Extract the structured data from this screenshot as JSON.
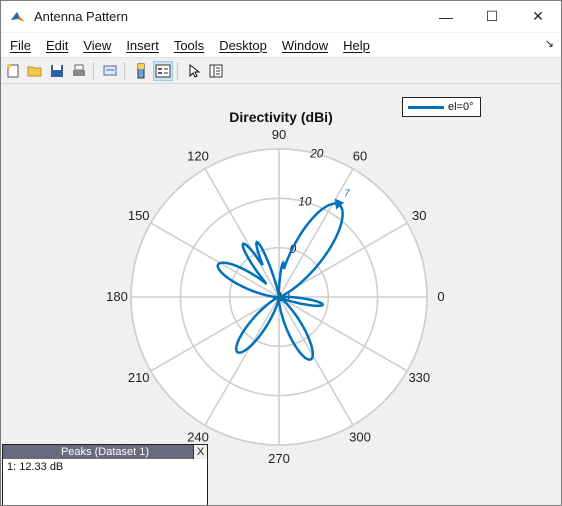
{
  "window": {
    "title": "Antenna Pattern",
    "controls": {
      "minimize": "—",
      "maximize": "☐",
      "close": "✕"
    }
  },
  "menu": {
    "items": [
      "File",
      "Edit",
      "View",
      "Insert",
      "Tools",
      "Desktop",
      "Window",
      "Help"
    ],
    "dock_arrow": "↘"
  },
  "toolbar": {
    "buttons": [
      "new-figure",
      "open-file",
      "save",
      "print",
      "link",
      "insert-colorbar",
      "insert-legend",
      "edit-plot",
      "property-inspector"
    ]
  },
  "chart_data": {
    "type": "polar",
    "title": "Directivity (dBi)",
    "legend": [
      "el=0°"
    ],
    "series_color": "#0072bd",
    "angle_labels": [
      "0",
      "30",
      "60",
      "90",
      "120",
      "150",
      "180",
      "210",
      "240",
      "270",
      "300",
      "330"
    ],
    "radial_labels": [
      "-10",
      "0",
      "10",
      "20"
    ],
    "rlim": [
      -10,
      20
    ],
    "peak_marker": {
      "angle_deg": 57,
      "value": 12.33,
      "label": "7"
    }
  },
  "peaks": {
    "title": "Peaks (Dataset 1)",
    "close": "X",
    "entries": [
      "1: 12.33 dB"
    ]
  }
}
